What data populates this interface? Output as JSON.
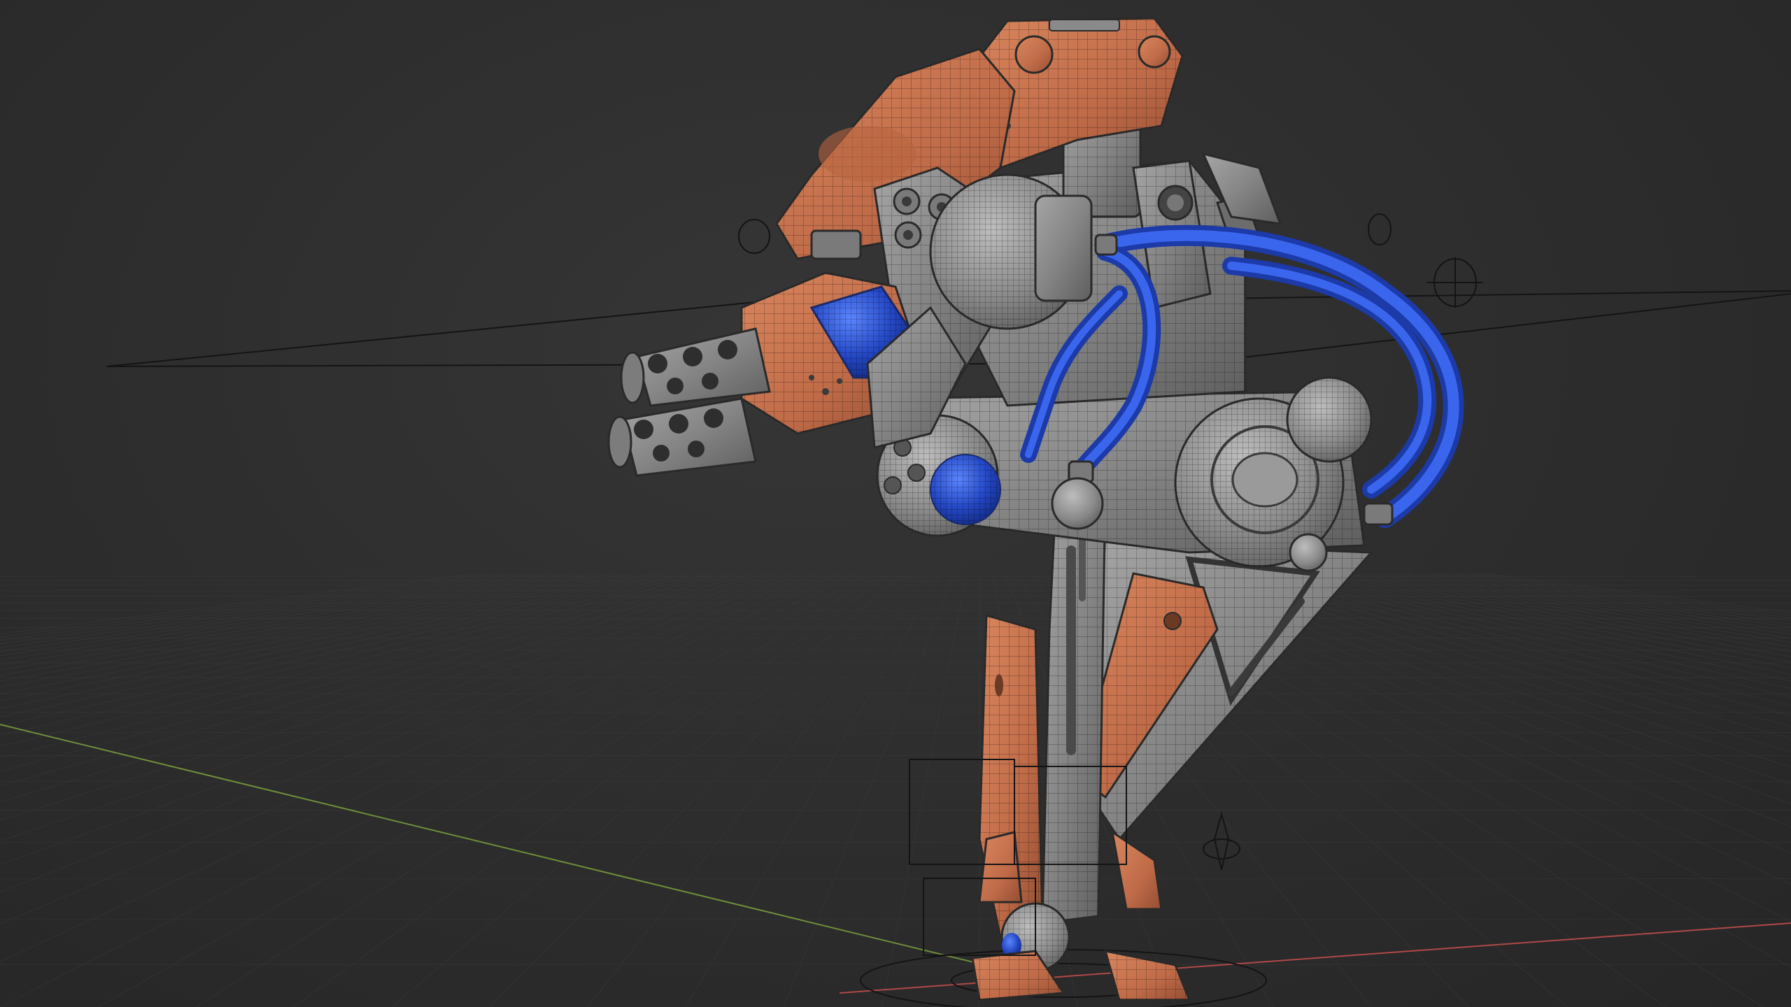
{
  "viewport": {
    "background": "#2b2b2b",
    "grid_color": "#3a3a3a",
    "x_axis_color": "#b04848",
    "y_axis_color": "#6e8f3a"
  },
  "model": {
    "armor_color": "#c8734f",
    "armor_shadow": "#9c5537",
    "metal_color": "#8c8c8c",
    "metal_dark": "#5c5c5c",
    "hose_color": "#2449c8",
    "hose_highlight": "#3f6cf0",
    "wire_color": "#3a3a3a"
  },
  "overlay": {
    "rig_color": "#141414"
  }
}
